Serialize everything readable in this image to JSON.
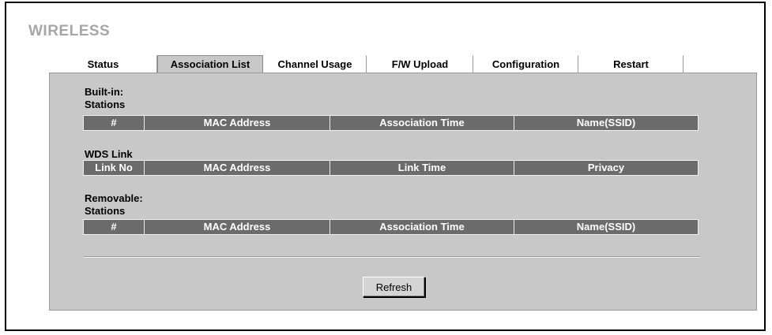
{
  "page_title": "WIRELESS",
  "tabs": [
    {
      "label": "Status",
      "active": false
    },
    {
      "label": "Association List",
      "active": true
    },
    {
      "label": "Channel Usage",
      "active": false
    },
    {
      "label": "F/W Upload",
      "active": false
    },
    {
      "label": "Configuration",
      "active": false
    },
    {
      "label": "Restart",
      "active": false
    }
  ],
  "builtin": {
    "title_line1": "Built-in:",
    "title_line2": "Stations",
    "columns": [
      "#",
      "MAC Address",
      "Association Time",
      "Name(SSID)"
    ]
  },
  "wds": {
    "title": "WDS Link",
    "columns": [
      "Link No",
      "MAC Address",
      "Link Time",
      "Privacy"
    ]
  },
  "removable": {
    "title_line1": "Removable:",
    "title_line2": "Stations",
    "columns": [
      "#",
      "MAC Address",
      "Association Time",
      "Name(SSID)"
    ]
  },
  "refresh_label": "Refresh",
  "colors": {
    "panel_bg": "#c8c8c8",
    "header_bg": "#6b6b6b",
    "title_color": "#a6a6a6"
  }
}
